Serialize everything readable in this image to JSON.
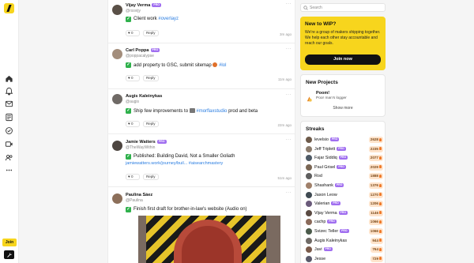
{
  "nav": {
    "join_label": "Join",
    "tool_symbol": "🔧",
    "icons": [
      "home-icon",
      "bell-icon",
      "mail-icon",
      "news-icon",
      "check-circle-icon",
      "video-icon",
      "users-icon",
      "more-icon"
    ]
  },
  "feed": {
    "posts": [
      {
        "name": "Vijay Verma",
        "pro": "PRO",
        "handle": "@rssvijy",
        "text": "Client work",
        "tag": "#overlayz",
        "likes": "0",
        "reply": "Reply",
        "time": "3m ago"
      },
      {
        "name": "Carl Poppa",
        "pro": "PRO",
        "handle": "@poppacalypse",
        "text": "add property to GSC, submit sitemap",
        "tag": "#lol",
        "likes": "0",
        "reply": "Reply",
        "time": "11m ago"
      },
      {
        "name": "Augis Kaleinykas",
        "handle": "@augis",
        "text_before": "Ship few improvements to",
        "tag": "#morflaxstudio",
        "text_after": "prod and beta",
        "likes": "0",
        "reply": "Reply",
        "time": "22m ago"
      },
      {
        "name": "Jamie Watters",
        "pro": "PRO",
        "handle": "@TheWayWithin",
        "text": "Published: Building David, Not a Smaller Goliath",
        "link": "jamiewatters.work/journey/buil...",
        "tag": "#aisearchmastery",
        "likes": "0",
        "reply": "Reply",
        "time": "51m ago"
      },
      {
        "name": "Paulina Sáez",
        "handle": "@Paulina",
        "text": "Finish first draft for brother-in-law's website (Audio on)"
      }
    ]
  },
  "sidebar": {
    "search_placeholder": "Search",
    "wip": {
      "title": "New to WIP?",
      "body": "We're a group of makers shipping together. We help each other stay accountable and reach our goals.",
      "join_label": "Join now"
    },
    "new_projects": {
      "title": "New Projects",
      "project_name": "Poom!",
      "project_desc": "Poor man's logger",
      "more_label": "Show more"
    },
    "streaks": {
      "title": "Streaks",
      "pro_label": "PRO",
      "rows": [
        {
          "name": "levelsio",
          "pro": true,
          "value": "2628"
        },
        {
          "name": "Jeff Triplett",
          "pro": true,
          "value": "2235"
        },
        {
          "name": "Fajar Siddiq",
          "pro": true,
          "value": "2077"
        },
        {
          "name": "Paul Grisel",
          "pro": true,
          "value": "2029"
        },
        {
          "name": "Rod",
          "pro": false,
          "value": "1888"
        },
        {
          "name": "Shashank",
          "pro": true,
          "value": "1376"
        },
        {
          "name": "Jason Leow",
          "pro": false,
          "value": "1270"
        },
        {
          "name": "Valerian",
          "pro": true,
          "value": "1206"
        },
        {
          "name": "Vijay Verma",
          "pro": true,
          "value": "1146"
        },
        {
          "name": "cachp",
          "pro": true,
          "value": "1066"
        },
        {
          "name": "Svizec Teller",
          "pro": true,
          "value": "1066"
        },
        {
          "name": "Augis Kaleinykas",
          "pro": false,
          "value": "944"
        },
        {
          "name": "Javi",
          "pro": true,
          "value": "764"
        },
        {
          "name": "Jesse",
          "pro": false,
          "value": "729"
        }
      ]
    }
  },
  "colors": {
    "brand_yellow": "#f7d51d",
    "pro_purple": "#a06ef0",
    "done_green": "#2fb14c",
    "link_blue": "#2a7de1"
  }
}
